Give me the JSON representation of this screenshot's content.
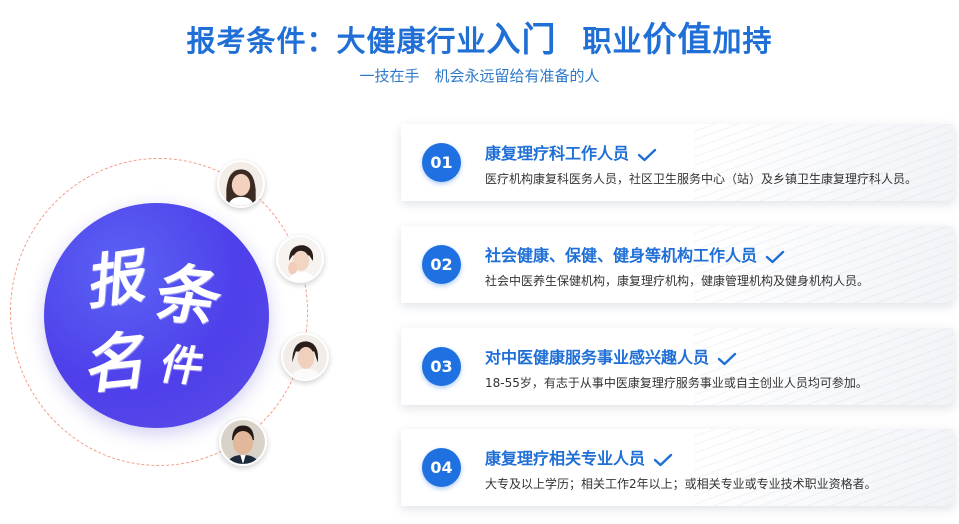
{
  "header": {
    "title_part1": "报考条件：大健康行业",
    "title_big1": "入门",
    "title_part2": "职业",
    "title_big2": "价值",
    "title_part3": "加持",
    "subtitle": "一技在手　机会永远留给有准备的人"
  },
  "badge": {
    "char1": "报",
    "char2": "条",
    "char3": "名",
    "char4": "件"
  },
  "colors": {
    "accent": "#1f6fd6",
    "disc": "#4e3fea",
    "orbit": "#f39c85"
  },
  "items": [
    {
      "num": "01",
      "title": "康复理疗科工作人员",
      "desc": "医疗机构康复科医务人员，社区卫生服务中心（站）及乡镇卫生康复理疗科人员。"
    },
    {
      "num": "02",
      "title": "社会健康、保健、健身等机构工作人员",
      "desc": "社会中医养生保健机构，康复理疗机构，健康管理机构及健身机构人员。"
    },
    {
      "num": "03",
      "title": "对中医健康服务事业感兴趣人员",
      "desc": "18-55岁，有志于从事中医康复理疗服务事业或自主创业人员均可参加。"
    },
    {
      "num": "04",
      "title": "康复理疗相关专业人员",
      "desc": "大专及以上学历；相关工作2年以上；或相关专业或专业技术职业资格者。"
    }
  ]
}
